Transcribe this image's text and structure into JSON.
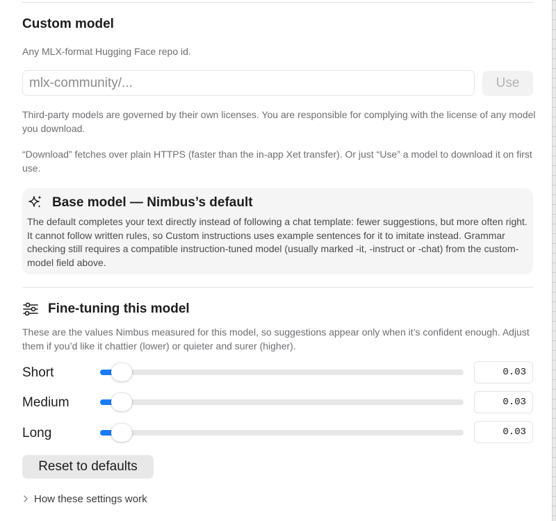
{
  "custom_model": {
    "title": "Custom model",
    "description": "Any MLX-format Hugging Face repo id.",
    "input_placeholder": "mlx-community/...",
    "use_label": "Use",
    "license_notice": "Third-party models are governed by their own licenses. You are responsible for complying with the license of any model you download.",
    "download_notice": "“Download” fetches over plain HTTPS (faster than the in-app Xet transfer). Or just “Use” a model to download it on first use."
  },
  "base_model": {
    "icon": "sparkles-icon",
    "title": "Base model — Nimbus’s default",
    "body": "The default completes your text directly instead of following a chat template: fewer suggestions, but more often right. It cannot follow written rules, so Custom instructions uses example sentences for it to imitate instead. Grammar checking still requires a compatible instruction-tuned model (usually marked -it, -instruct or -chat) from the custom-model field above."
  },
  "fine_tuning": {
    "icon": "sliders-icon",
    "title": "Fine-tuning this model",
    "description": "These are the values Nimbus measured for this model, so suggestions appear only when it’s confident enough. Adjust them if you’d like it chattier (lower) or quieter and surer (higher).",
    "rows": [
      {
        "label": "Short",
        "value": "0.03",
        "level": 0.03
      },
      {
        "label": "Medium",
        "value": "0.03",
        "level": 0.03
      },
      {
        "label": "Long",
        "value": "0.03",
        "level": 0.03
      }
    ],
    "reset_label": "Reset to defaults",
    "help_label": "How these settings work"
  },
  "colors": {
    "accent": "#1a7cf7",
    "card_bg": "#f5f5f5",
    "secondary_text": "#6e6e73"
  }
}
